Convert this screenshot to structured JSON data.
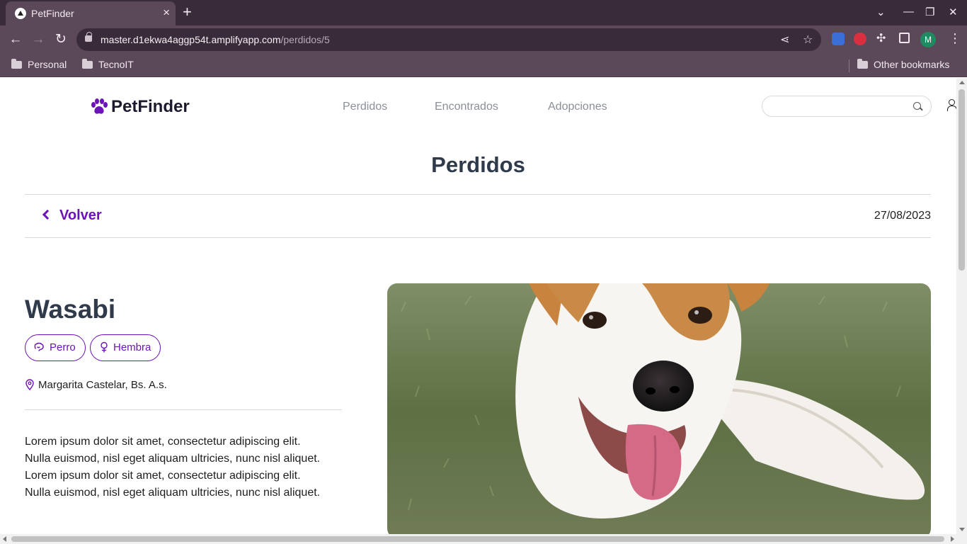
{
  "browser": {
    "tab_title": "PetFinder",
    "new_tab_symbol": "+",
    "close_tab_symbol": "×",
    "url_host": "master.d1ekwa4aggp54t.amplifyapp.com",
    "url_path": "/perdidos/5",
    "avatar_letter": "M",
    "bookmarks": [
      "Personal",
      "TecnoIT"
    ],
    "other_bookmarks": "Other bookmarks"
  },
  "site": {
    "logo_text": "PetFinder",
    "nav": [
      "Perdidos",
      "Encontrados",
      "Adopciones"
    ],
    "search_placeholder": ""
  },
  "section_title": "Perdidos",
  "back_label": "Volver",
  "date": "27/08/2023",
  "pet": {
    "name": "Wasabi",
    "species": "Perro",
    "sex": "Hembra",
    "location": "Margarita Castelar, Bs. A.s.",
    "description": [
      "Lorem ipsum dolor sit amet, consectetur adipiscing elit.",
      "Nulla euismod, nisl eget aliquam ultricies, nunc nisl aliquet.",
      "Lorem ipsum dolor sit amet, consectetur adipiscing elit.",
      "Nulla euismod, nisl eget aliquam ultricies, nunc nisl aliquet."
    ]
  },
  "colors": {
    "accent": "#6c14b7",
    "heading": "#2f3a4a",
    "chrome_dark": "#3a2b3a",
    "chrome": "#5b4858"
  }
}
